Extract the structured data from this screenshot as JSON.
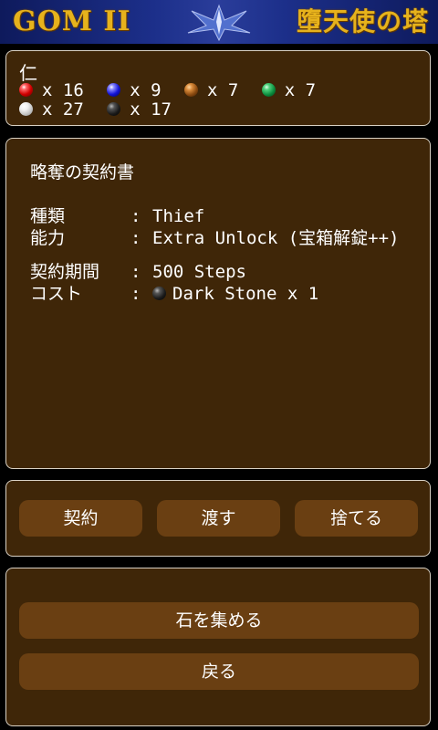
{
  "banner": {
    "logo_left": "GOM II",
    "logo_right": "墮天使の塔"
  },
  "inventory": {
    "owner": "仁",
    "stones": [
      {
        "icon": "red-stone-icon",
        "color": "#d10000",
        "count": "x 16"
      },
      {
        "icon": "blue-stone-icon",
        "color": "#1414d8",
        "count": "x 9"
      },
      {
        "icon": "brown-stone-icon",
        "color": "#8a4a10",
        "count": "x 7"
      },
      {
        "icon": "green-stone-icon",
        "color": "#0a8a3c",
        "count": "x 7"
      },
      {
        "icon": "white-stone-icon",
        "color": "#f0f0f0",
        "count": "x 27"
      },
      {
        "icon": "dark-stone-icon",
        "color": "#1a1a1a",
        "count": "x 17"
      }
    ]
  },
  "contract": {
    "title": "略奪の契約書",
    "type_label": "種類",
    "type_value": "Thief",
    "ability_label": "能力",
    "ability_value": "Extra Unlock (宝箱解錠++)",
    "term_label": "契約期間",
    "term_value": "500 Steps",
    "cost_label": "コスト",
    "cost_value": "Dark Stone x 1",
    "separator": ":"
  },
  "actions": {
    "contract_label": "契約",
    "give_label": "渡す",
    "discard_label": "捨てる"
  },
  "menu": {
    "collect_label": "石を集める",
    "back_label": "戻る"
  },
  "colors": {
    "panel_bg": "#3f2608",
    "panel_border": "#d9d1c4",
    "button_bg": "#6a3f12",
    "banner_gold": "#e6b21c",
    "banner_blue": "#1c2f8a"
  }
}
